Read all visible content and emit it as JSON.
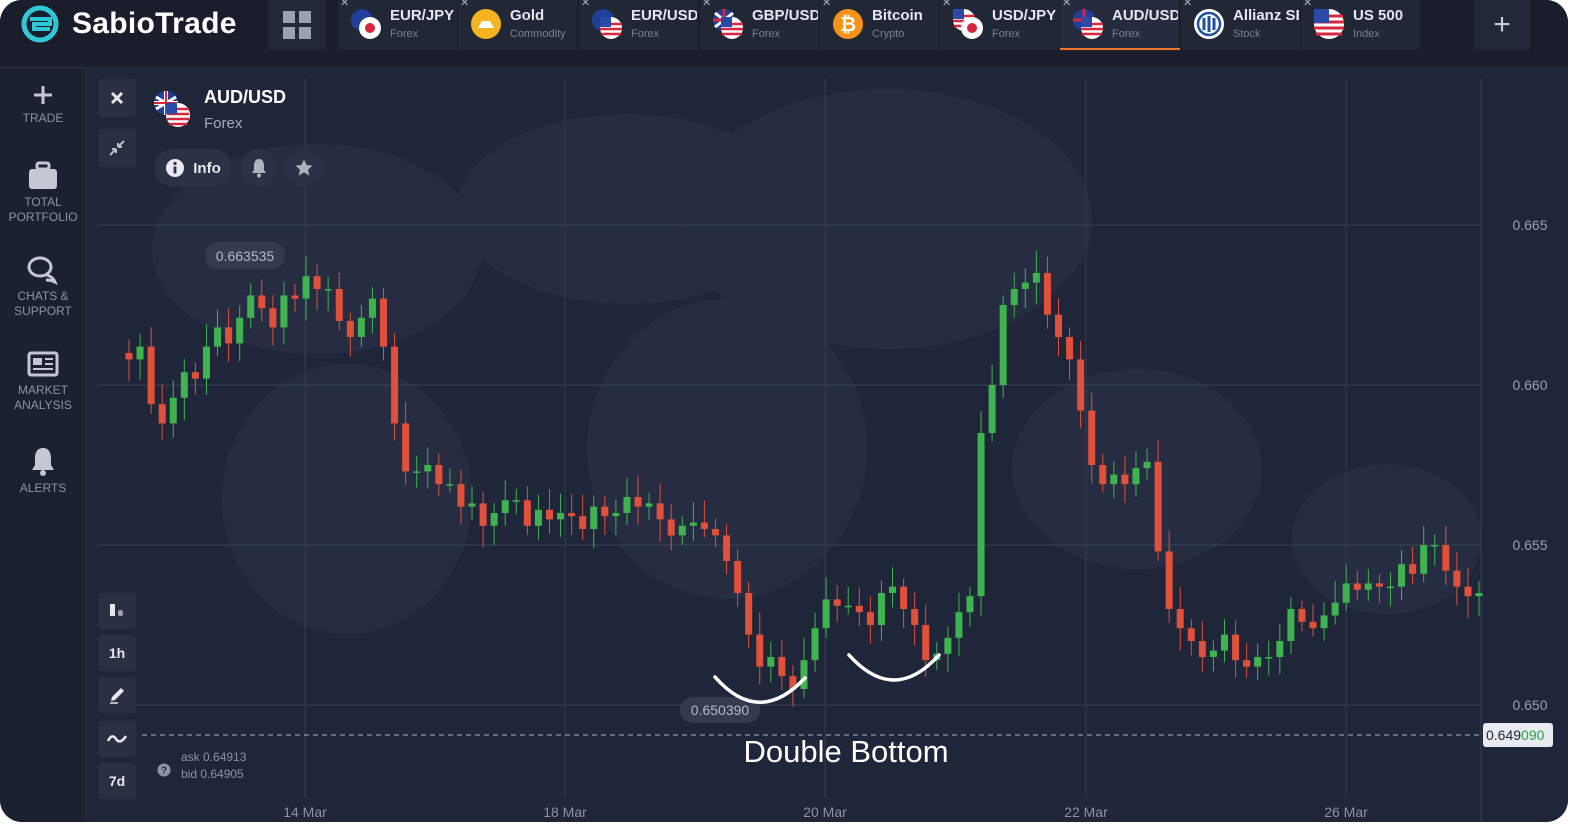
{
  "app": {
    "name": "SabioTrade"
  },
  "tabs": [
    {
      "name": "EUR/JPY",
      "type": "Forex",
      "icon": "eur-jpy-flag-icon",
      "active": false
    },
    {
      "name": "Gold",
      "type": "Commodity",
      "icon": "gold-coin-icon",
      "active": false
    },
    {
      "name": "EUR/USD",
      "type": "Forex",
      "icon": "eur-usd-flag-icon",
      "active": false
    },
    {
      "name": "GBP/USD",
      "type": "Forex",
      "icon": "gbp-usd-flag-icon",
      "active": false
    },
    {
      "name": "Bitcoin",
      "type": "Crypto",
      "icon": "bitcoin-icon",
      "active": false
    },
    {
      "name": "USD/JPY",
      "type": "Forex",
      "icon": "usd-jpy-flag-icon",
      "active": false
    },
    {
      "name": "AUD/USD",
      "type": "Forex",
      "icon": "aud-usd-flag-icon",
      "active": true
    },
    {
      "name": "Allianz SE",
      "type": "Stock",
      "icon": "allianz-logo-icon",
      "active": false
    },
    {
      "name": "US 500",
      "type": "Index",
      "icon": "us-flag-icon",
      "active": false
    }
  ],
  "sidebar": [
    {
      "label": "TRADE",
      "icon": "plus-icon"
    },
    {
      "label": "TOTAL PORTFOLIO",
      "icon": "briefcase-icon"
    },
    {
      "label": "CHATS & SUPPORT",
      "icon": "chat-bubbles-icon"
    },
    {
      "label": "MARKET ANALYSIS",
      "icon": "newspaper-icon"
    },
    {
      "label": "ALERTS",
      "icon": "bell-icon"
    }
  ],
  "asset": {
    "name": "AUD/USD",
    "type": "Forex"
  },
  "actions": {
    "info_label": "Info"
  },
  "toolbar": {
    "timeframe": "1h",
    "range": "7d"
  },
  "quote": {
    "ask": "ask 0.64913",
    "bid": "bid 0.64905"
  },
  "annotation": {
    "text": "Double Bottom"
  },
  "colors": {
    "up": "#3fb34f",
    "down": "#e0503a",
    "accent": "#f0762e",
    "background": "#20263a"
  },
  "chart_data": {
    "type": "candlestick",
    "symbol": "AUD/USD",
    "interval": "1h",
    "y_ticks": [
      "0.665",
      "0.660",
      "0.655",
      "0.650"
    ],
    "ylim": [
      0.648,
      0.6675
    ],
    "x_ticks": [
      "14 Mar",
      "18 Mar",
      "20 Mar",
      "22 Mar",
      "26 Mar"
    ],
    "high_label": "0.663535",
    "low_label": "0.650390",
    "current_price": {
      "main": "0.649",
      "highlight": "090"
    },
    "series": [
      {
        "name": "close",
        "y": [
          0.6608,
          0.6612,
          0.6594,
          0.6588,
          0.6596,
          0.6604,
          0.6602,
          0.6612,
          0.6618,
          0.6613,
          0.6621,
          0.6628,
          0.6624,
          0.6618,
          0.6628,
          0.6627,
          0.6634,
          0.663,
          0.663,
          0.662,
          0.6615,
          0.6621,
          0.6627,
          0.6612,
          0.6588,
          0.6573,
          0.6573,
          0.6575,
          0.6569,
          0.6569,
          0.6562,
          0.6563,
          0.6556,
          0.656,
          0.6564,
          0.6564,
          0.6556,
          0.6561,
          0.6558,
          0.656,
          0.6559,
          0.6555,
          0.6562,
          0.6559,
          0.656,
          0.6565,
          0.6562,
          0.6563,
          0.6558,
          0.6553,
          0.6556,
          0.6557,
          0.6555,
          0.6553,
          0.6545,
          0.6535,
          0.6522,
          0.6512,
          0.6515,
          0.6509,
          0.6505,
          0.6514,
          0.6524,
          0.6533,
          0.6531,
          0.6531,
          0.6529,
          0.6525,
          0.6535,
          0.6537,
          0.653,
          0.6525,
          0.6514,
          0.6516,
          0.6521,
          0.6529,
          0.6534,
          0.6585,
          0.66,
          0.6625,
          0.663,
          0.6632,
          0.6635,
          0.6622,
          0.6615,
          0.6608,
          0.6592,
          0.6575,
          0.6569,
          0.6572,
          0.6569,
          0.6574,
          0.6576,
          0.6548,
          0.653,
          0.6524,
          0.652,
          0.6515,
          0.6517,
          0.6522,
          0.6514,
          0.6512,
          0.6515,
          0.6515,
          0.652,
          0.653,
          0.6526,
          0.6524,
          0.6528,
          0.6532,
          0.6538,
          0.6536,
          0.6538,
          0.6537,
          0.6537,
          0.6544,
          0.6541,
          0.655,
          0.655,
          0.6542,
          0.6537,
          0.6534,
          0.6535
        ]
      }
    ]
  }
}
